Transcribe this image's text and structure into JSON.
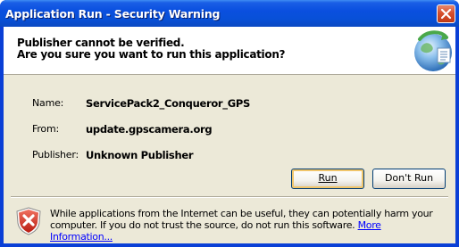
{
  "window": {
    "title": "Application Run - Security Warning"
  },
  "header": {
    "line1": "Publisher cannot be verified.",
    "line2": "Are you sure you want to run this application?"
  },
  "details": [
    {
      "label": "Name:",
      "value": "ServicePack2_Conqueror_GPS"
    },
    {
      "label": "From:",
      "value": "update.gpscamera.org"
    },
    {
      "label": "Publisher:",
      "value": "Unknown Publisher"
    }
  ],
  "buttons": {
    "run_label": "Run",
    "dont_run_label": "Don't Run"
  },
  "warning": {
    "text_part1": "While applications from the Internet can be useful, they can potentially harm your computer. If you do not trust the source, do not run this software. ",
    "more_info_label": "More Information..."
  },
  "icons": {
    "close": "close-icon",
    "globe": "globe-icon",
    "shield": "shield-warning-icon"
  },
  "colors": {
    "titlebar": "#0a4fdf",
    "close_button": "#d6502e",
    "dialog_bg": "#ece9d8",
    "link": "#0000ff",
    "focus_ring": "#f0c56a"
  }
}
